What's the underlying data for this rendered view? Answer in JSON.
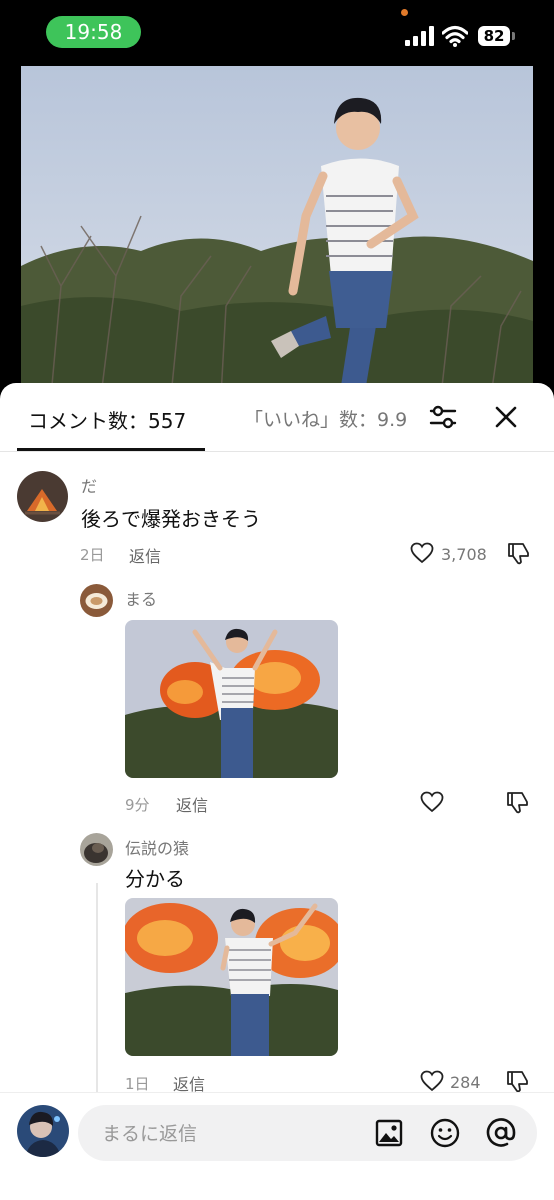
{
  "status_bar": {
    "time": "19:58",
    "battery": "82",
    "accent_color": "#3ec45a"
  },
  "icons": {
    "signal": "cellular-signal-icon",
    "wifi": "wifi-icon",
    "filter": "sliders-icon",
    "close": "close-icon",
    "like": "heart-icon",
    "dislike": "thumbs-down-icon",
    "image": "image-icon",
    "emoji": "smiley-icon",
    "mention": "at-sign-icon"
  },
  "comments_panel": {
    "comments_tab_label": "コメント数：557",
    "likes_tab_label": "「いいね」数：9.9"
  },
  "comments": [
    {
      "username": "だ",
      "text": "後ろで爆発おきそう",
      "time": "2日",
      "reply_label": "返信",
      "like_count": "3,708"
    },
    {
      "username": "まる",
      "text": "",
      "time": "9分",
      "reply_label": "返信",
      "like_count": ""
    },
    {
      "username": "伝説の猿",
      "text": "分かる",
      "time": "1日",
      "reply_label": "返信",
      "like_count": "284"
    }
  ],
  "reply_bar": {
    "placeholder": "まるに返信"
  }
}
